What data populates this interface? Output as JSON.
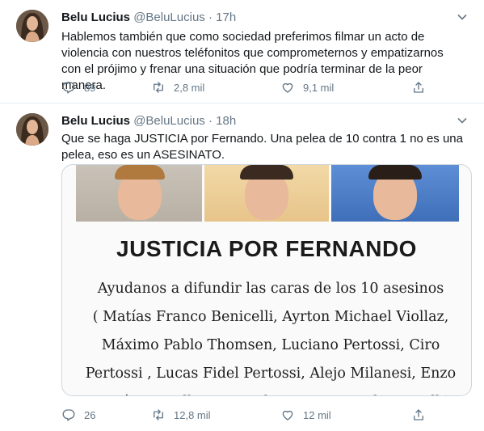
{
  "tweets": [
    {
      "name": "Belu Lucius",
      "handle": "@BeluLucius",
      "separator": "·",
      "time": "17h",
      "text": "Hablemos también que como sociedad preferimos filmar un acto de violencia con nuestros teléfonitos que comprometernos y empatizarnos con el prójimo y frenar una situación que podría terminar de la peor manera.",
      "replies": "89",
      "retweets": "2,8 mil",
      "likes": "9,1 mil"
    },
    {
      "name": "Belu Lucius",
      "handle": "@BeluLucius",
      "separator": "·",
      "time": "18h",
      "text": "Que se haga JUSTICIA por Fernando. Una pelea de 10 contra 1 no es una pelea, eso es un ASESINATO.",
      "replies": "26",
      "retweets": "12,8 mil",
      "likes": "12 mil",
      "media": {
        "title": "JUSTICIA POR FERNANDO",
        "lines": [
          "Ayudanos a difundir las caras de los 10 asesinos",
          "( Matías Franco Benicelli, Ayrton Michael Viollaz,",
          "Máximo Pablo Thomsen, Luciano Pertossi, Ciro",
          "Pertossi , Lucas Fidel Pertossi, Alejo Milanesi, Enzo",
          "Tomás Comelli, Juan Pedro Guarino y Blas Cinalli)"
        ]
      }
    }
  ],
  "icons": {
    "reply": "reply-icon",
    "retweet": "retweet-icon",
    "like": "heart-icon",
    "share": "share-icon",
    "caret": "chevron-down-icon"
  },
  "colors": {
    "text": "#14171a",
    "muted": "#657786",
    "divider": "#e6ecf0"
  }
}
